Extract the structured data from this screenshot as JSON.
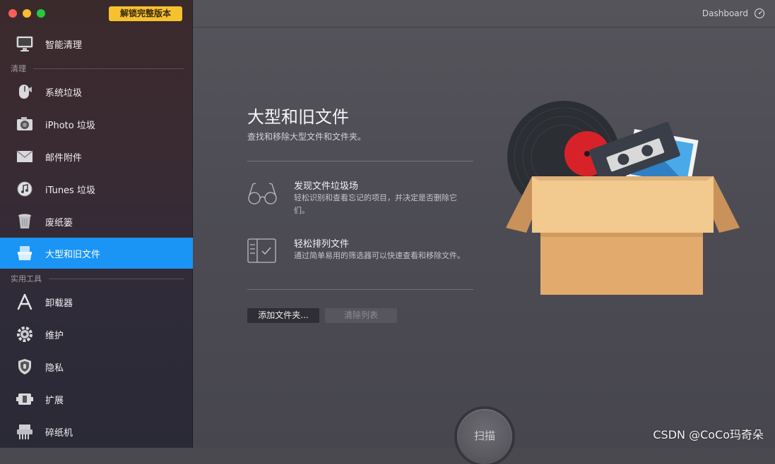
{
  "sidebar": {
    "unlock_label": "解锁完整版本",
    "top_item": {
      "label": "智能清理",
      "icon": "monitor-icon"
    },
    "section_clean": "清理",
    "clean_items": [
      {
        "label": "系统垃圾",
        "icon": "system-junk-icon"
      },
      {
        "label": "iPhoto 垃圾",
        "icon": "camera-icon"
      },
      {
        "label": "邮件附件",
        "icon": "mail-icon"
      },
      {
        "label": "iTunes 垃圾",
        "icon": "music-icon"
      },
      {
        "label": "废纸篓",
        "icon": "trash-icon"
      },
      {
        "label": "大型和旧文件",
        "icon": "box-icon",
        "active": true
      }
    ],
    "section_tools": "实用工具",
    "tool_items": [
      {
        "label": "卸载器",
        "icon": "uninstaller-icon"
      },
      {
        "label": "维护",
        "icon": "gear-icon"
      },
      {
        "label": "隐私",
        "icon": "privacy-shield-icon"
      },
      {
        "label": "扩展",
        "icon": "extension-icon"
      },
      {
        "label": "碎纸机",
        "icon": "shredder-icon"
      }
    ]
  },
  "topbar": {
    "dashboard_label": "Dashboard"
  },
  "main": {
    "title": "大型和旧文件",
    "subtitle": "查找和移除大型文件和文件夹。",
    "features": [
      {
        "title": "发现文件垃圾场",
        "desc": "轻松识别和查看忘记的项目，并决定是否删除它们。"
      },
      {
        "title": "轻松排列文件",
        "desc": "通过简单易用的筛选器可以快速查看和移除文件。"
      }
    ],
    "add_folder_label": "添加文件夹...",
    "clear_list_label": "清除列表",
    "scan_label": "扫描"
  },
  "watermark": "CSDN @CoCo玛奇朵",
  "colors": {
    "accent": "#1a95f5",
    "unlock_badge": "#f6c12e"
  }
}
